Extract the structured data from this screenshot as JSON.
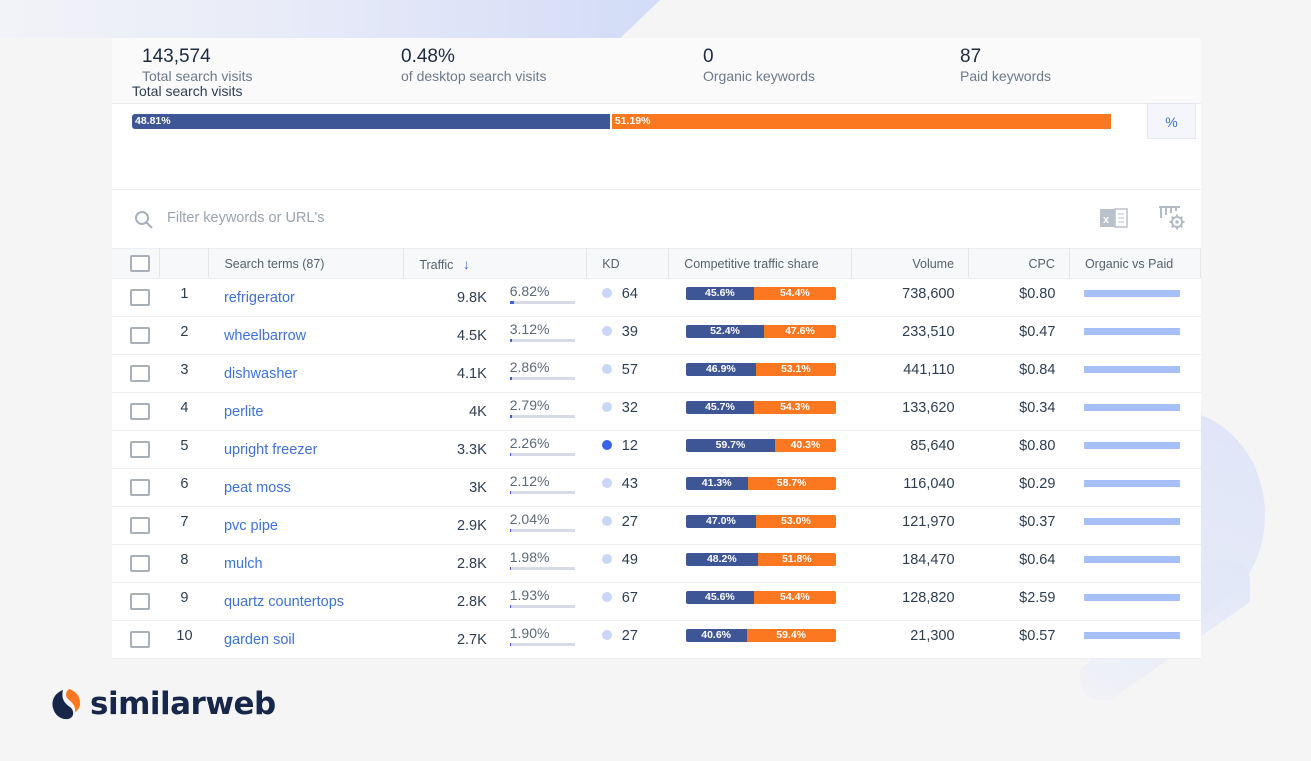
{
  "stats": [
    {
      "value": "143,574",
      "label": "Total search visits"
    },
    {
      "value": "0.48%",
      "label": "of desktop search visits"
    },
    {
      "value": "0",
      "label": "Organic keywords"
    },
    {
      "value": "87",
      "label": "Paid keywords"
    }
  ],
  "total_search_visits": {
    "title": "Total search visits",
    "paid_share_percent": 48.81,
    "organic_share_percent": 51.19,
    "paid_label": "48.81%",
    "organic_label": "51.19%",
    "toggle_label": "%"
  },
  "search": {
    "placeholder": "Filter keywords or URL's"
  },
  "colors": {
    "paid": "#3f5696",
    "organic": "#fb7821",
    "link": "#3f72d9",
    "accent": "#3c63e0"
  },
  "table": {
    "headers": {
      "search_terms": "Search terms (87)",
      "traffic": "Traffic",
      "kd": "KD",
      "cts": "Competitive traffic share",
      "volume": "Volume",
      "cpc": "CPC",
      "ovp": "Organic vs Paid"
    },
    "rows": [
      {
        "n": "1",
        "kw": "refrigerator",
        "traffic": "9.8K",
        "share": "6.82%",
        "kd": "64",
        "cts_a": "45.6%",
        "cts_b": "54.4%",
        "volume": "738,600",
        "cpc": "$0.80"
      },
      {
        "n": "2",
        "kw": "wheelbarrow",
        "traffic": "4.5K",
        "share": "3.12%",
        "kd": "39",
        "cts_a": "52.4%",
        "cts_b": "47.6%",
        "volume": "233,510",
        "cpc": "$0.47"
      },
      {
        "n": "3",
        "kw": "dishwasher",
        "traffic": "4.1K",
        "share": "2.86%",
        "kd": "57",
        "cts_a": "46.9%",
        "cts_b": "53.1%",
        "volume": "441,110",
        "cpc": "$0.84"
      },
      {
        "n": "4",
        "kw": "perlite",
        "traffic": "4K",
        "share": "2.79%",
        "kd": "32",
        "cts_a": "45.7%",
        "cts_b": "54.3%",
        "volume": "133,620",
        "cpc": "$0.34"
      },
      {
        "n": "5",
        "kw": "upright freezer",
        "traffic": "3.3K",
        "share": "2.26%",
        "kd": "12",
        "cts_a": "59.7%",
        "cts_b": "40.3%",
        "volume": "85,640",
        "cpc": "$0.80"
      },
      {
        "n": "6",
        "kw": "peat moss",
        "traffic": "3K",
        "share": "2.12%",
        "kd": "43",
        "cts_a": "41.3%",
        "cts_b": "58.7%",
        "volume": "116,040",
        "cpc": "$0.29"
      },
      {
        "n": "7",
        "kw": "pvc pipe",
        "traffic": "2.9K",
        "share": "2.04%",
        "kd": "27",
        "cts_a": "47.0%",
        "cts_b": "53.0%",
        "volume": "121,970",
        "cpc": "$0.37"
      },
      {
        "n": "8",
        "kw": "mulch",
        "traffic": "2.8K",
        "share": "1.98%",
        "kd": "49",
        "cts_a": "48.2%",
        "cts_b": "51.8%",
        "volume": "184,470",
        "cpc": "$0.64"
      },
      {
        "n": "9",
        "kw": "quartz countertops",
        "traffic": "2.8K",
        "share": "1.93%",
        "kd": "67",
        "cts_a": "45.6%",
        "cts_b": "54.4%",
        "volume": "128,820",
        "cpc": "$2.59"
      },
      {
        "n": "10",
        "kw": "garden soil",
        "traffic": "2.7K",
        "share": "1.90%",
        "kd": "27",
        "cts_a": "40.6%",
        "cts_b": "59.4%",
        "volume": "21,300",
        "cpc": "$0.57"
      }
    ]
  },
  "brand": {
    "name": "similarweb"
  }
}
